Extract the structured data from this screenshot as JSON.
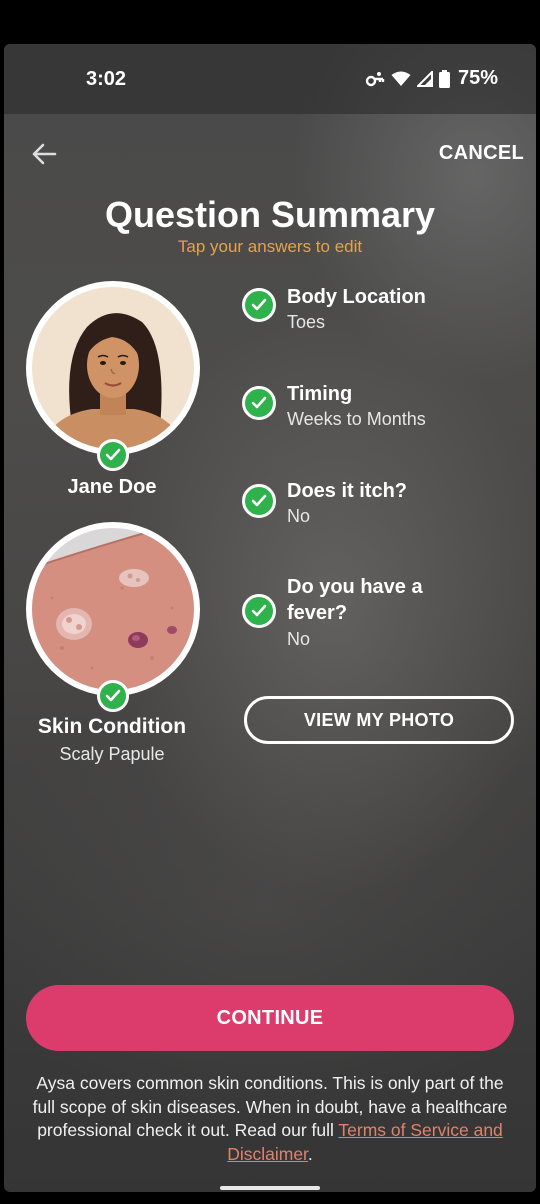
{
  "status_bar": {
    "time": "3:02",
    "battery": "75%",
    "icons": [
      "key-icon",
      "wifi-icon",
      "signal-icon",
      "battery-icon"
    ]
  },
  "header": {
    "back_icon": "arrow-left-icon",
    "cancel_label": "CANCEL",
    "title": "Question Summary",
    "subtitle": "Tap your answers to edit"
  },
  "profile": {
    "name": "Jane Doe"
  },
  "condition": {
    "name": "Skin Condition",
    "value": "Scaly Papule"
  },
  "answers": [
    {
      "question": "Body Location",
      "answer": "Toes"
    },
    {
      "question": "Timing",
      "answer": "Weeks to Months"
    },
    {
      "question": "Does it itch?",
      "answer": "No"
    },
    {
      "question": "Do you have a fever?",
      "answer": "No"
    }
  ],
  "buttons": {
    "view_photo": "VIEW MY PHOTO",
    "continue": "CONTINUE"
  },
  "disclaimer": {
    "text": "Aysa covers common skin conditions. This is only part of the full scope of skin diseases. When in doubt, have a healthcare professional check it out. Read our full ",
    "link": "Terms of Service and Disclaimer",
    "end": "."
  },
  "colors": {
    "accent_orange": "#e6a24a",
    "check_green": "#2fb24c",
    "continue_pink": "#dc3c6c",
    "link": "#e0826a"
  }
}
